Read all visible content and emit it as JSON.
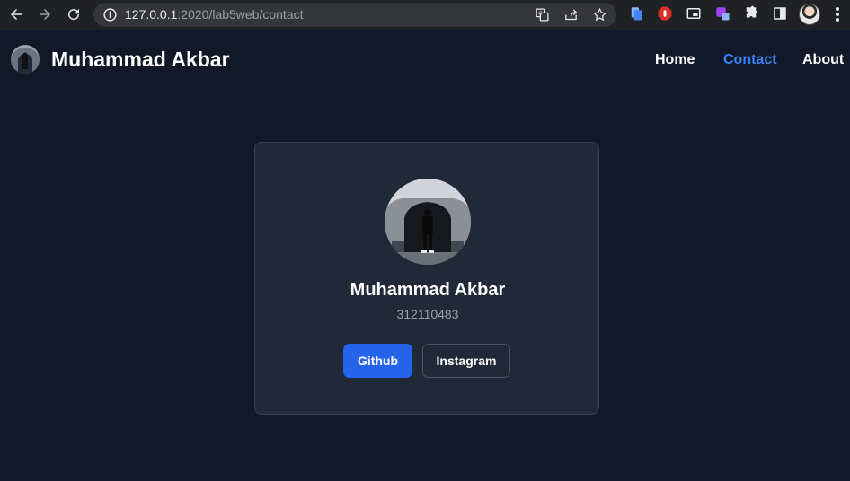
{
  "browser": {
    "url_host": "127.0.0.1",
    "url_rest": ":2020/lab5web/contact"
  },
  "site": {
    "title": "Muhammad Akbar",
    "nav": [
      {
        "label": "Home"
      },
      {
        "label": "Contact"
      },
      {
        "label": "About"
      }
    ],
    "active_nav": "Contact",
    "accent_color": "#3b82f6"
  },
  "profile_card": {
    "name": "Muhammad Akbar",
    "id_number": "312110483",
    "buttons": {
      "github_label": "Github",
      "instagram_label": "Instagram"
    },
    "primary_color": "#2563eb"
  }
}
